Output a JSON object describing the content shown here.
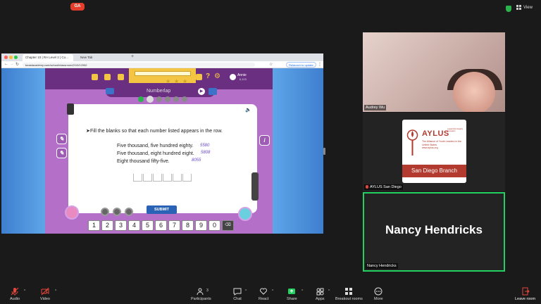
{
  "zoom": {
    "view_label": "View",
    "accent_green": "#23d160",
    "toolbar": [
      {
        "key": "audio",
        "label": "Audio"
      },
      {
        "key": "video",
        "label": "Video"
      },
      {
        "key": "participants",
        "label": "Participants",
        "count": "3"
      },
      {
        "key": "chat",
        "label": "Chat"
      },
      {
        "key": "react",
        "label": "React"
      },
      {
        "key": "share",
        "label": "Share"
      },
      {
        "key": "apps",
        "label": "Apps"
      },
      {
        "key": "breakout",
        "label": "Breakout rooms"
      },
      {
        "key": "more",
        "label": "More"
      },
      {
        "key": "leave",
        "label": "Leave room"
      }
    ]
  },
  "participants": [
    {
      "name": "Audrey Wu"
    },
    {
      "name": "AYLUS San Diego"
    },
    {
      "name": "Nancy Hendricks",
      "display": "Nancy Hendricks"
    }
  ],
  "aylus_logo": {
    "title": "AYLUS",
    "small": "Leadership Integrity Innovation",
    "subtitle": "The Alliance of Youth Leaders in the United States",
    "url": "www.aylus.org",
    "branch": "San Diego Branch"
  },
  "browser": {
    "tabs": [
      {
        "title": "Chapter 10 | RA Level 2 | Co..."
      },
      {
        "title": "New Tab"
      }
    ],
    "url": "beastacademy.com/school/classroom/2/10/12952",
    "relaunch": "Relaunch to update"
  },
  "game": {
    "logo": "GA",
    "user_name": "Annie",
    "user_score": "6,103",
    "title": "Numberlap",
    "instruction": "Fill the blanks so that each number listed appears in the row.",
    "lines": [
      {
        "text": "Five thousand, five hundred eighty.",
        "answer": "5580"
      },
      {
        "text": "Five thousand, eight hundred eight.",
        "answer": "5808"
      },
      {
        "text": "Eight thousand fifty-five.",
        "answer": "8055"
      }
    ],
    "submit": "SUBMIT",
    "info": "i",
    "keypad": [
      "1",
      "2",
      "3",
      "4",
      "5",
      "6",
      "7",
      "8",
      "9",
      "0"
    ],
    "delete_key": "⌫"
  }
}
